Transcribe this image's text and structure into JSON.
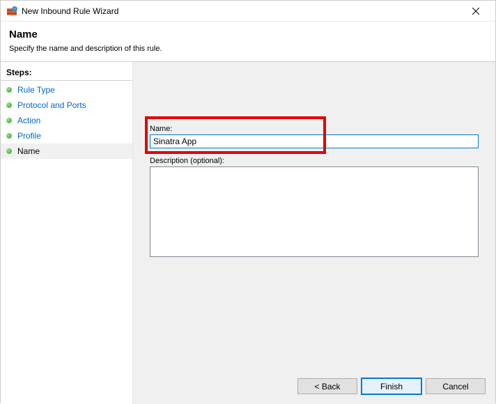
{
  "window": {
    "title": "New Inbound Rule Wizard"
  },
  "header": {
    "title": "Name",
    "subtitle": "Specify the name and description of this rule."
  },
  "sidebar": {
    "title": "Steps:",
    "items": [
      {
        "label": "Rule Type"
      },
      {
        "label": "Protocol and Ports"
      },
      {
        "label": "Action"
      },
      {
        "label": "Profile"
      },
      {
        "label": "Name"
      }
    ],
    "currentIndex": 4
  },
  "form": {
    "name_label": "Name:",
    "name_value": "Sinatra App",
    "desc_label": "Description (optional):",
    "desc_value": ""
  },
  "buttons": {
    "back": "< Back",
    "finish": "Finish",
    "cancel": "Cancel"
  }
}
